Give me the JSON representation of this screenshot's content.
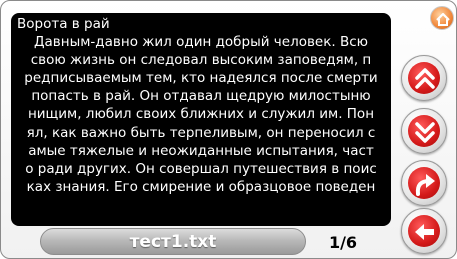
{
  "reader": {
    "lines": [
      "Ворота в рай",
      "Давным-давно жил один добрый человек. Всю",
      "свою жизнь он следовал высоким заповедям, п",
      "редписываемым тем, кто надеялся после смерти",
      "попасть в рай. Он отдавал щедрую милостыню",
      "нищим, любил своих ближних и служил им. Пон",
      "ял, как важно быть терпеливым, он переносил с",
      "амые тяжелые и неожиданные испытания, част",
      "о ради других. Он совершал путешествия в поис",
      "ках знания. Его смирение и образцовое поведен"
    ]
  },
  "footer": {
    "filename": "тест1.txt",
    "page": "1/6"
  },
  "icons": {
    "home": "home-icon",
    "page_up": "double-chevron-up-icon",
    "page_down": "double-chevron-down-icon",
    "turn": "curved-arrow-icon",
    "back": "arrow-left-icon"
  },
  "colors": {
    "accent": "#d41a1a",
    "home": "#f0873a",
    "reader_bg": "#000000"
  }
}
